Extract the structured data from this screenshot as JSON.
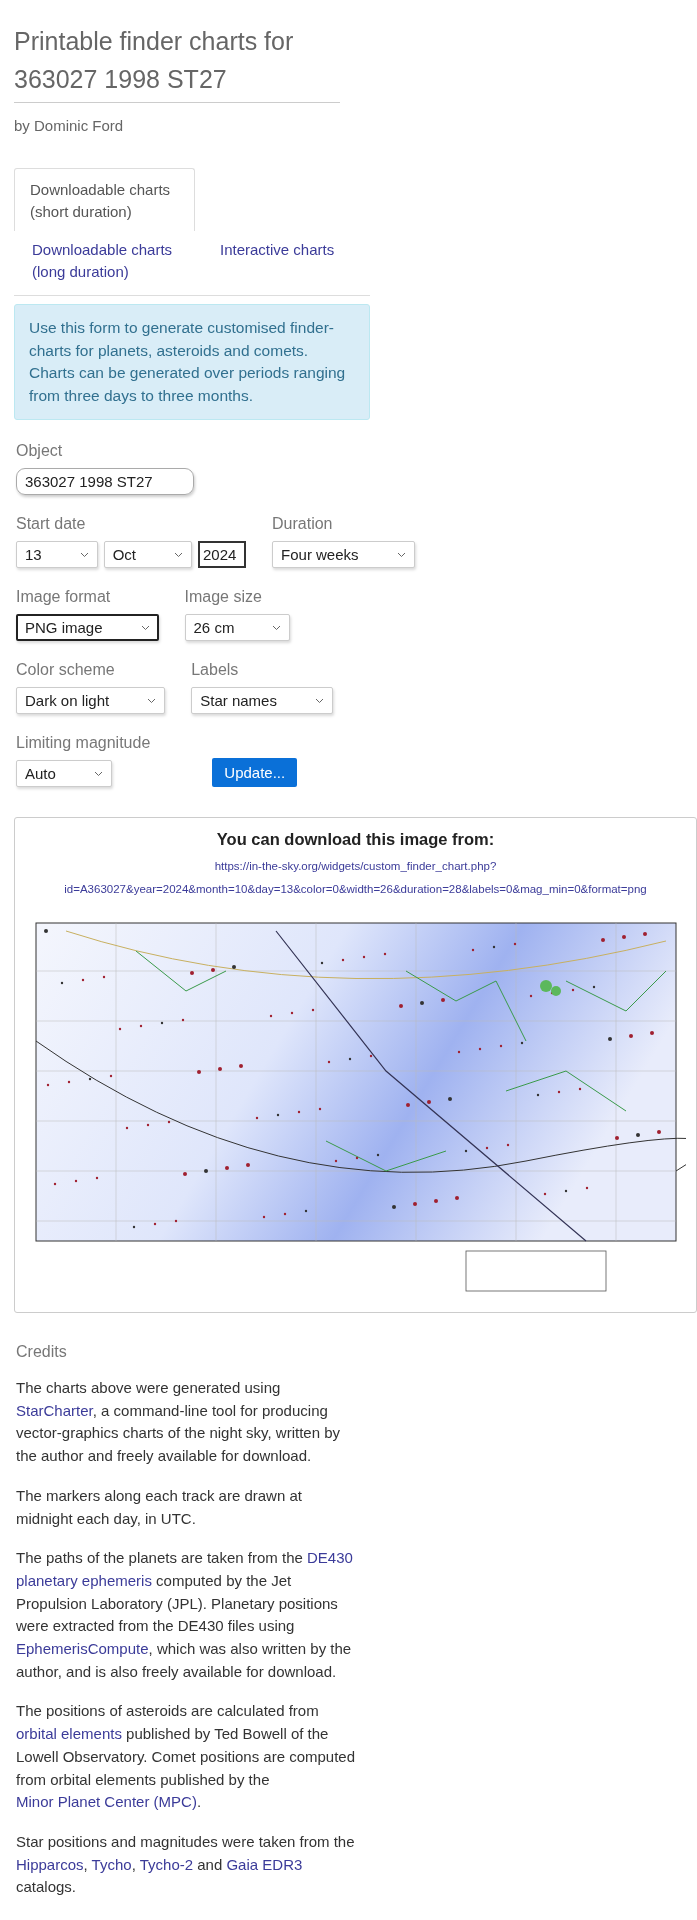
{
  "header": {
    "title": "Printable finder charts for 363027 1998 ST27",
    "byline": "by Dominic Ford"
  },
  "tabs": [
    {
      "label": "Downloadable charts (short duration)",
      "selected": true
    },
    {
      "label": "Downloadable charts (long duration)",
      "selected": false
    },
    {
      "label": "Interactive charts",
      "selected": false
    }
  ],
  "info": "Use this form to generate customised finder-charts for planets, asteroids and comets. Charts can be generated over periods ranging from three days to three months.",
  "form": {
    "rows": [
      [
        {
          "label": "Object",
          "controls": [
            {
              "kind": "text",
              "value": "363027 1998 ST27",
              "focused": false
            }
          ]
        }
      ],
      [
        {
          "label": "Start date",
          "controls": [
            {
              "kind": "select",
              "value": "13",
              "focused": false
            },
            {
              "kind": "select",
              "value": "Oct",
              "focused": false
            },
            {
              "kind": "input",
              "value": "2024",
              "focused": true
            }
          ]
        },
        {
          "label": "Duration",
          "controls": [
            {
              "kind": "select",
              "value": "Four weeks",
              "focused": false
            }
          ]
        }
      ],
      [
        {
          "label": "Image format",
          "controls": [
            {
              "kind": "select",
              "value": "PNG image",
              "focused": true
            }
          ]
        },
        {
          "label": "Image size",
          "controls": [
            {
              "kind": "select",
              "value": "26 cm",
              "focused": false
            }
          ]
        }
      ],
      [
        {
          "label": "Color scheme",
          "controls": [
            {
              "kind": "select",
              "value": "Dark on light",
              "focused": false
            }
          ]
        },
        {
          "label": "Labels",
          "controls": [
            {
              "kind": "select",
              "value": "Star names",
              "focused": false
            }
          ]
        }
      ],
      [
        {
          "label": "Limiting magnitude",
          "controls": [
            {
              "kind": "select",
              "value": "Auto",
              "focused": false
            }
          ]
        },
        {
          "controls": [
            {
              "kind": "button",
              "value": "Update...",
              "focused": false
            }
          ]
        }
      ]
    ]
  },
  "download": {
    "heading": "You can download this image from:",
    "url": "https://in-the-sky.org/widgets/custom_finder_chart.php?id=A363027&year=2024&month=10&day=13&color=0&width=26&duration=28&labels=0&mag_min=0&format=png"
  },
  "credits": {
    "heading": "Credits",
    "paragraphs": [
      [
        {
          "kind": "plain",
          "text": "The charts above were generated using "
        },
        {
          "kind": "link",
          "text": "StarCharter"
        },
        {
          "kind": "plain",
          "text": ", a command-line tool for producing vector-graphics charts of the night sky, written by the author and freely available for download."
        }
      ],
      [
        {
          "kind": "plain",
          "text": "The markers along each track are drawn at midnight each day, in UTC."
        }
      ],
      [
        {
          "kind": "plain",
          "text": "The paths of the planets are taken from the "
        },
        {
          "kind": "link",
          "text": "DE430"
        },
        {
          "kind": "link",
          "text": "planetary ephemeris"
        },
        {
          "kind": "plain",
          "text": " computed by the Jet Propulsion Laboratory (JPL). Planetary positions were extracted from the DE430 files using "
        },
        {
          "kind": "link",
          "text": "EphemerisCompute"
        },
        {
          "kind": "plain",
          "text": ", which was also written by the author, and is also freely available for download."
        }
      ],
      [
        {
          "kind": "plain",
          "text": "The positions of asteroids are calculated from "
        },
        {
          "kind": "link",
          "text": "orbital elements"
        },
        {
          "kind": "plain",
          "text": " published by Ted Bowell of the Lowell Observatory. Comet positions are computed from orbital elements published by the "
        },
        {
          "kind": "link",
          "text": "Minor Planet Center (MPC)"
        },
        {
          "kind": "plain",
          "text": "."
        }
      ],
      [
        {
          "kind": "plain",
          "text": "Star positions and magnitudes were taken from the "
        },
        {
          "kind": "link",
          "text": "Hipparcos"
        },
        {
          "kind": "plain",
          "text": ", "
        },
        {
          "kind": "link",
          "text": "Tycho"
        },
        {
          "kind": "plain",
          "text": ", "
        },
        {
          "kind": "link",
          "text": "Tycho-2"
        },
        {
          "kind": "plain",
          "text": " and "
        },
        {
          "kind": "link",
          "text": "Gaia EDR3"
        },
        {
          "kind": "plain",
          "text": " catalogs."
        }
      ]
    ]
  }
}
